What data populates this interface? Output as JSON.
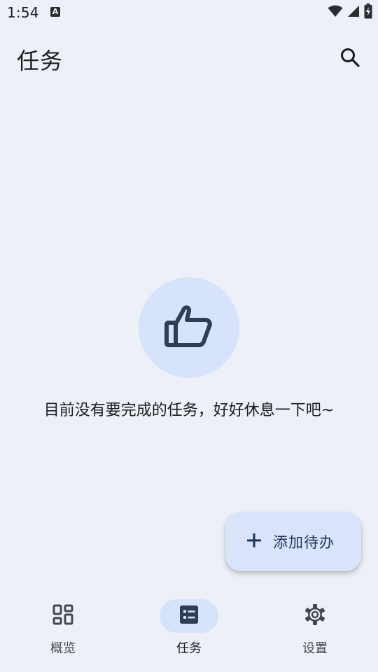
{
  "status_bar": {
    "time": "1:54",
    "notification_icon": "A"
  },
  "app_bar": {
    "title": "任务"
  },
  "empty_state": {
    "icon": "thumbs-up-icon",
    "message": "目前没有要完成的任务，好好休息一下吧~"
  },
  "fab": {
    "label": "添加待办"
  },
  "bottom_nav": {
    "items": [
      {
        "label": "概览",
        "icon": "dashboard-icon",
        "active": false
      },
      {
        "label": "任务",
        "icon": "task-list-icon",
        "active": true
      },
      {
        "label": "设置",
        "icon": "gear-icon",
        "active": false
      }
    ]
  },
  "colors": {
    "background": "#eef0f7",
    "accent_container": "#d7e3fa",
    "icon_dark": "#2f3e54"
  }
}
